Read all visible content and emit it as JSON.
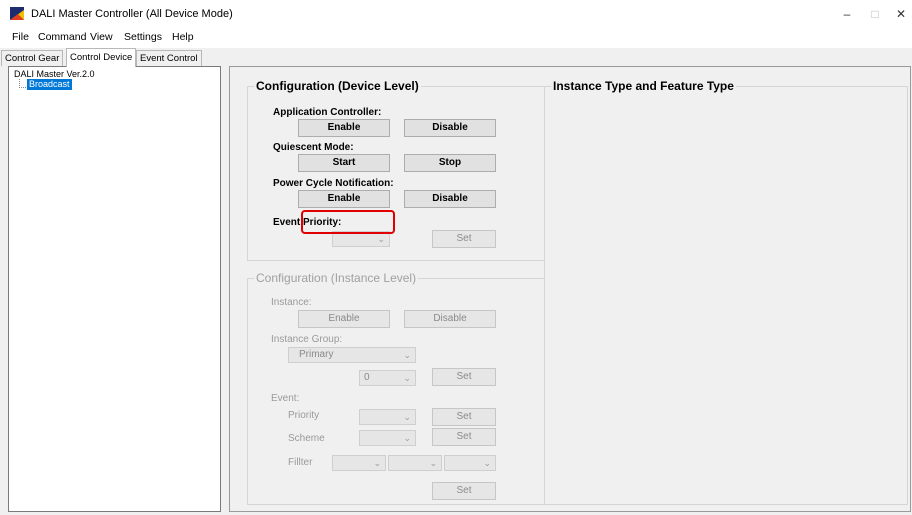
{
  "window": {
    "title": "DALI Master Controller (All Device Mode)",
    "minimize_icon": "minimize-icon",
    "maximize_icon": "maximize-icon",
    "close_icon": "close-icon",
    "minimize_glyph": "–",
    "maximize_glyph": "□",
    "close_glyph": "✕"
  },
  "menu": [
    "File",
    "Command",
    "View",
    "Settings",
    "Help"
  ],
  "tabs": [
    "Control Gear",
    "Control Device",
    "Event Control"
  ],
  "active_tab": "Control Device",
  "tree": {
    "root": "DALI Master Ver.2.0",
    "selected": "Broadcast"
  },
  "device_level": {
    "legend": "Configuration (Device Level)",
    "app_controller": {
      "label": "Application Controller:",
      "enable": "Enable",
      "disable": "Disable"
    },
    "quiescent": {
      "label": "Quiescent Mode:",
      "start": "Start",
      "stop": "Stop"
    },
    "power_cycle": {
      "label": "Power Cycle Notification:",
      "enable": "Enable",
      "disable": "Disable"
    },
    "event_priority": {
      "label": "Event Priority:",
      "value": "",
      "set": "Set"
    }
  },
  "instance_level": {
    "legend": "Configuration (Instance Level)",
    "instance": {
      "label": "Instance:",
      "enable": "Enable",
      "disable": "Disable"
    },
    "instance_group": {
      "label": "Instance Group:",
      "group_value": "Primary",
      "number_value": "0",
      "set": "Set"
    },
    "event": {
      "label": "Event:",
      "priority_label": "Priority",
      "priority_set": "Set",
      "scheme_label": "Scheme",
      "scheme_set": "Set",
      "filter_label": "Fillter",
      "filter_set": "Set"
    }
  },
  "instance_types": {
    "legend": "Instance Type and Feature Type"
  },
  "colors": {
    "highlight": "#e00000",
    "selection": "#0078d7"
  }
}
